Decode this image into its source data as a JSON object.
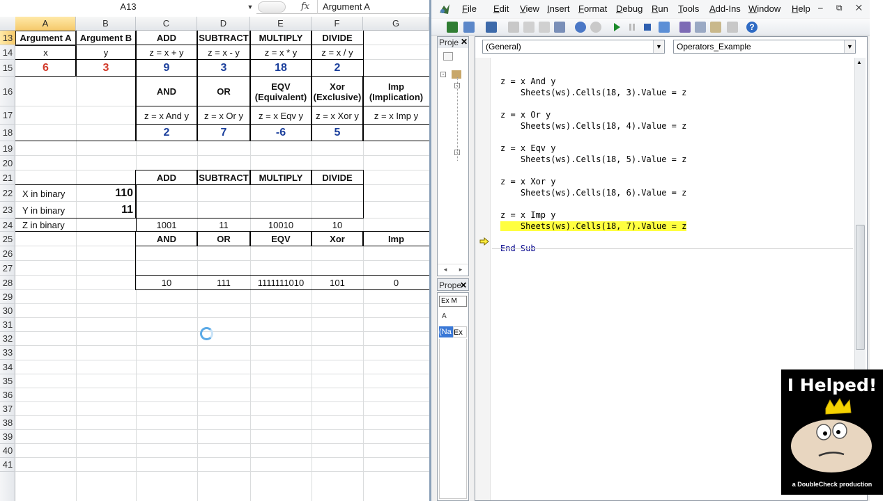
{
  "excel": {
    "namebox": "A13",
    "fx_label": "fx",
    "formula_content": "Argument A",
    "columns": [
      "A",
      "B",
      "C",
      "D",
      "E",
      "F",
      "G"
    ],
    "rows": [
      "13",
      "14",
      "15",
      "16",
      "17",
      "18",
      "19",
      "20",
      "21",
      "22",
      "23",
      "24",
      "25",
      "26",
      "27",
      "28",
      "29",
      "30",
      "31",
      "32",
      "33",
      "34",
      "35",
      "36",
      "37",
      "38",
      "39",
      "40",
      "41"
    ],
    "table1": {
      "headers": [
        "Argument A",
        "Argument B",
        "ADD",
        "SUBTRACT",
        "MULTIPLY",
        "DIVIDE"
      ],
      "formulas": [
        "x",
        "y",
        "z = x + y",
        "z = x - y",
        "z = x * y",
        "z = x / y"
      ],
      "values": [
        "6",
        "3",
        "9",
        "3",
        "18",
        "2"
      ]
    },
    "table2": {
      "headers": [
        "AND",
        "OR",
        "EQV\n(Equivalent)",
        "Xor\n(Exclusive)",
        "Imp\n(Implication)"
      ],
      "header_lines": [
        [
          "AND"
        ],
        [
          "OR"
        ],
        [
          "EQV",
          "(Equivalent)"
        ],
        [
          "Xor",
          "(Exclusive)"
        ],
        [
          "Imp",
          "(Implication)"
        ]
      ],
      "formulas": [
        "z = x And y",
        "z = x Or y",
        "z = x Eqv y",
        "z = x Xor y",
        "z = x Imp y"
      ],
      "values": [
        "2",
        "7",
        "-6",
        "5",
        ""
      ]
    },
    "table3": {
      "headers": [
        "ADD",
        "SUBTRACT",
        "MULTIPLY",
        "DIVIDE"
      ],
      "x_label": "X in binary",
      "x_value": "110",
      "y_label": "Y in binary",
      "y_value": "11",
      "z_label": "Z in binary",
      "z_values": [
        "1001",
        "11",
        "10010",
        "10"
      ]
    },
    "table4": {
      "headers": [
        "AND",
        "OR",
        "EQV",
        "Xor",
        "Imp"
      ],
      "values": [
        "10",
        "111",
        "1111111010",
        "101",
        "0"
      ]
    }
  },
  "vbe": {
    "menus": [
      "File",
      "Edit",
      "View",
      "Insert",
      "Format",
      "Debug",
      "Run",
      "Tools",
      "Add-Ins",
      "Window",
      "Help"
    ],
    "window_controls": "– ⧉ ✕",
    "project_title": "Proje",
    "properties_title": "Prope",
    "prop_combo": "Ex M",
    "prop_tab": "A",
    "prop_name_label": "(Na",
    "prop_name_value": "Ex",
    "combo_general": "(General)",
    "combo_proc": "Operators_Example",
    "code_lines": [
      "z = x And y",
      "    Sheets(ws).Cells(18, 3).Value = z",
      "",
      "z = x Or y",
      "    Sheets(ws).Cells(18, 4).Value = z",
      "",
      "z = x Eqv y",
      "    Sheets(ws).Cells(18, 5).Value = z",
      "",
      "z = x Xor y",
      "    Sheets(ws).Cells(18, 6).Value = z",
      "",
      "z = x Imp y",
      "    Sheets(ws).Cells(18, 7).Value = z",
      "",
      "End Sub"
    ],
    "highlight_line_index": 13
  },
  "badge": {
    "title": "I Helped!",
    "credit": "a DoubleCheck production"
  },
  "colors": {
    "red_value": "#d23a2a",
    "blue_value": "#1b3f9c",
    "highlight": "#ffff40",
    "keyword": "#00008b"
  }
}
